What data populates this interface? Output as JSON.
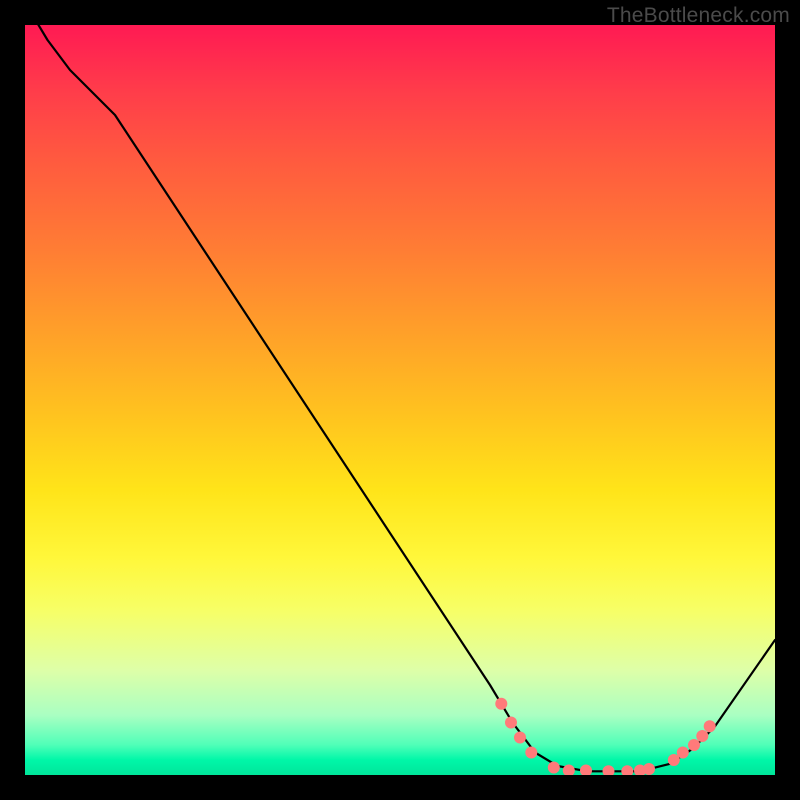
{
  "attribution": "TheBottleneck.com",
  "colors": {
    "background": "#000000",
    "curve": "#000000",
    "dot": "#ff7a7a",
    "attribution_text": "#4b4b4b"
  },
  "chart_data": {
    "type": "line",
    "title": "",
    "xlabel": "",
    "ylabel": "",
    "xlim": [
      0,
      100
    ],
    "ylim": [
      0,
      100
    ],
    "curve": [
      {
        "x": 0,
        "y": 103
      },
      {
        "x": 3,
        "y": 98
      },
      {
        "x": 6,
        "y": 94
      },
      {
        "x": 9,
        "y": 91
      },
      {
        "x": 12,
        "y": 88
      },
      {
        "x": 62,
        "y": 12
      },
      {
        "x": 65,
        "y": 7
      },
      {
        "x": 68,
        "y": 3
      },
      {
        "x": 71,
        "y": 1.2
      },
      {
        "x": 75,
        "y": 0.5
      },
      {
        "x": 82,
        "y": 0.5
      },
      {
        "x": 86,
        "y": 1.5
      },
      {
        "x": 89,
        "y": 3.5
      },
      {
        "x": 92,
        "y": 6.5
      },
      {
        "x": 100,
        "y": 18
      }
    ],
    "dots": [
      {
        "x": 63.5,
        "y": 9.5
      },
      {
        "x": 64.8,
        "y": 7.0
      },
      {
        "x": 66.0,
        "y": 5.0
      },
      {
        "x": 67.5,
        "y": 3.0
      },
      {
        "x": 70.5,
        "y": 1.0
      },
      {
        "x": 72.5,
        "y": 0.6
      },
      {
        "x": 74.8,
        "y": 0.6
      },
      {
        "x": 77.8,
        "y": 0.5
      },
      {
        "x": 80.3,
        "y": 0.5
      },
      {
        "x": 82.0,
        "y": 0.6
      },
      {
        "x": 83.2,
        "y": 0.8
      },
      {
        "x": 86.5,
        "y": 2.0
      },
      {
        "x": 87.7,
        "y": 3.0
      },
      {
        "x": 89.2,
        "y": 4.0
      },
      {
        "x": 90.3,
        "y": 5.2
      },
      {
        "x": 91.3,
        "y": 6.5
      }
    ]
  }
}
